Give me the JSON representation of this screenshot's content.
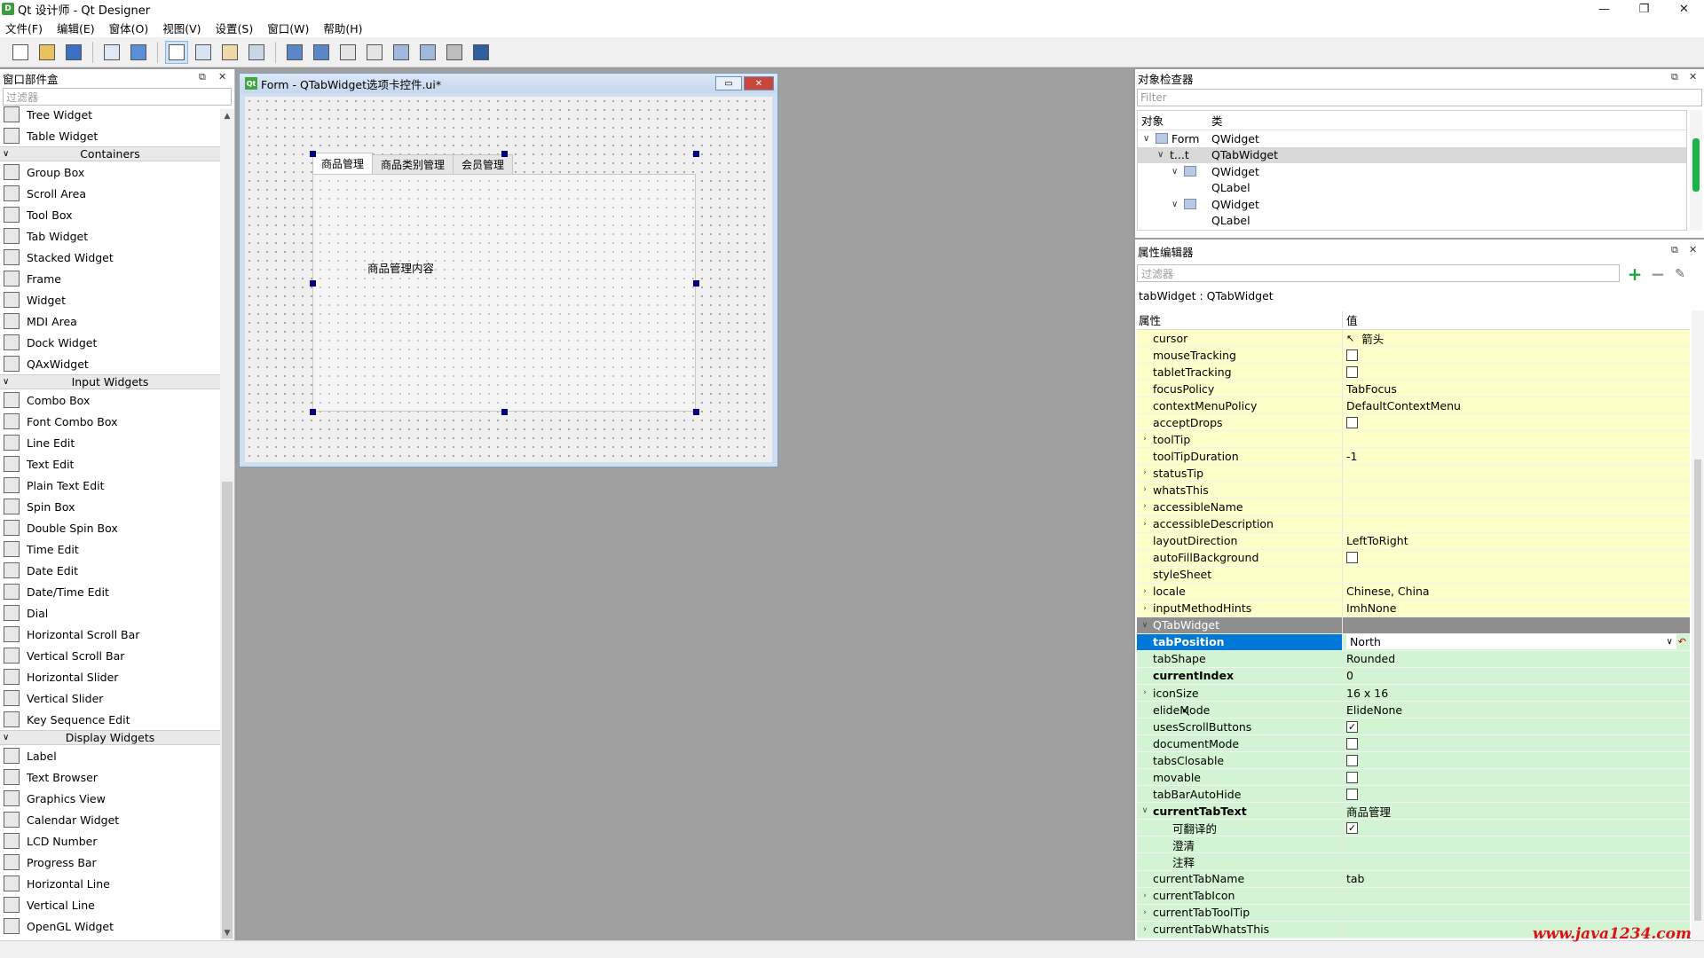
{
  "window": {
    "title": "Qt 设计师 - Qt Designer",
    "app_icon": "D",
    "controls": [
      "—",
      "❐",
      "✕"
    ]
  },
  "menubar": [
    "文件(F)",
    "编辑(E)",
    "窗体(O)",
    "视图(V)",
    "设置(S)",
    "窗口(W)",
    "帮助(H)"
  ],
  "widget_box": {
    "title": "窗口部件盒",
    "filter_placeholder": "过滤器",
    "items": [
      {
        "kind": "item",
        "label": "Tree Widget"
      },
      {
        "kind": "item",
        "label": "Table Widget"
      },
      {
        "kind": "category",
        "label": "Containers"
      },
      {
        "kind": "item",
        "label": "Group Box"
      },
      {
        "kind": "item",
        "label": "Scroll Area"
      },
      {
        "kind": "item",
        "label": "Tool Box"
      },
      {
        "kind": "item",
        "label": "Tab Widget"
      },
      {
        "kind": "item",
        "label": "Stacked Widget"
      },
      {
        "kind": "item",
        "label": "Frame"
      },
      {
        "kind": "item",
        "label": "Widget"
      },
      {
        "kind": "item",
        "label": "MDI Area"
      },
      {
        "kind": "item",
        "label": "Dock Widget"
      },
      {
        "kind": "item",
        "label": "QAxWidget"
      },
      {
        "kind": "category",
        "label": "Input Widgets"
      },
      {
        "kind": "item",
        "label": "Combo Box"
      },
      {
        "kind": "item",
        "label": "Font Combo Box"
      },
      {
        "kind": "item",
        "label": "Line Edit"
      },
      {
        "kind": "item",
        "label": "Text Edit"
      },
      {
        "kind": "item",
        "label": "Plain Text Edit"
      },
      {
        "kind": "item",
        "label": "Spin Box"
      },
      {
        "kind": "item",
        "label": "Double Spin Box"
      },
      {
        "kind": "item",
        "label": "Time Edit"
      },
      {
        "kind": "item",
        "label": "Date Edit"
      },
      {
        "kind": "item",
        "label": "Date/Time Edit"
      },
      {
        "kind": "item",
        "label": "Dial"
      },
      {
        "kind": "item",
        "label": "Horizontal Scroll Bar"
      },
      {
        "kind": "item",
        "label": "Vertical Scroll Bar"
      },
      {
        "kind": "item",
        "label": "Horizontal Slider"
      },
      {
        "kind": "item",
        "label": "Vertical Slider"
      },
      {
        "kind": "item",
        "label": "Key Sequence Edit"
      },
      {
        "kind": "category",
        "label": "Display Widgets"
      },
      {
        "kind": "item",
        "label": "Label"
      },
      {
        "kind": "item",
        "label": "Text Browser"
      },
      {
        "kind": "item",
        "label": "Graphics View"
      },
      {
        "kind": "item",
        "label": "Calendar Widget"
      },
      {
        "kind": "item",
        "label": "LCD Number"
      },
      {
        "kind": "item",
        "label": "Progress Bar"
      },
      {
        "kind": "item",
        "label": "Horizontal Line"
      },
      {
        "kind": "item",
        "label": "Vertical Line"
      },
      {
        "kind": "item",
        "label": "OpenGL Widget"
      }
    ]
  },
  "form": {
    "title": "Form - QTabWidget选项卡控件.ui*",
    "icon": "Qt",
    "tabs": [
      "商品管理",
      "商品类别管理",
      "会员管理"
    ],
    "current_tab": 0,
    "tab_content_label": "商品管理内容"
  },
  "object_inspector": {
    "title": "对象检查器",
    "filter_placeholder": "Filter",
    "col_object": "对象",
    "col_class": "类",
    "rows": [
      {
        "depth": 0,
        "expand": "∨",
        "name": "Form",
        "cls": "QWidget",
        "icon": true,
        "selected": false
      },
      {
        "depth": 1,
        "expand": "∨",
        "name": "t...t",
        "cls": "QTabWidget",
        "icon": false,
        "selected": true
      },
      {
        "depth": 2,
        "expand": "∨",
        "name": "",
        "cls": "QWidget",
        "icon": true,
        "selected": false
      },
      {
        "depth": 3,
        "expand": "",
        "name": "",
        "cls": "QLabel",
        "icon": false,
        "selected": false
      },
      {
        "depth": 2,
        "expand": "∨",
        "name": "",
        "cls": "QWidget",
        "icon": true,
        "selected": false
      },
      {
        "depth": 3,
        "expand": "",
        "name": "",
        "cls": "QLabel",
        "icon": false,
        "selected": false
      }
    ]
  },
  "property_editor": {
    "title": "属性编辑器",
    "filter_placeholder": "过滤器",
    "object_label": "tabWidget : QTabWidget",
    "col_property": "属性",
    "col_value": "值",
    "rows": [
      {
        "name": "cursor",
        "value": "箭头",
        "type": "cursor",
        "color": "yellow",
        "expand": ""
      },
      {
        "name": "mouseTracking",
        "value": "",
        "type": "check",
        "checked": false,
        "color": "yellow",
        "expand": ""
      },
      {
        "name": "tabletTracking",
        "value": "",
        "type": "check",
        "checked": false,
        "color": "yellow",
        "expand": ""
      },
      {
        "name": "focusPolicy",
        "value": "TabFocus",
        "type": "text",
        "color": "yellow",
        "expand": ""
      },
      {
        "name": "contextMenuPolicy",
        "value": "DefaultContextMenu",
        "type": "text",
        "color": "yellow",
        "expand": ""
      },
      {
        "name": "acceptDrops",
        "value": "",
        "type": "check",
        "checked": false,
        "color": "yellow",
        "expand": ""
      },
      {
        "name": "toolTip",
        "value": "",
        "type": "text",
        "color": "yellow",
        "expand": "›"
      },
      {
        "name": "toolTipDuration",
        "value": "-1",
        "type": "text",
        "color": "yellow",
        "expand": ""
      },
      {
        "name": "statusTip",
        "value": "",
        "type": "text",
        "color": "yellow",
        "expand": "›"
      },
      {
        "name": "whatsThis",
        "value": "",
        "type": "text",
        "color": "yellow",
        "expand": "›"
      },
      {
        "name": "accessibleName",
        "value": "",
        "type": "text",
        "color": "yellow",
        "expand": "›"
      },
      {
        "name": "accessibleDescription",
        "value": "",
        "type": "text",
        "color": "yellow",
        "expand": "›"
      },
      {
        "name": "layoutDirection",
        "value": "LeftToRight",
        "type": "text",
        "color": "yellow",
        "expand": ""
      },
      {
        "name": "autoFillBackground",
        "value": "",
        "type": "check",
        "checked": false,
        "color": "yellow",
        "expand": ""
      },
      {
        "name": "styleSheet",
        "value": "",
        "type": "text",
        "color": "yellow",
        "expand": ""
      },
      {
        "name": "locale",
        "value": "Chinese, China",
        "type": "text",
        "color": "yellow",
        "expand": "›"
      },
      {
        "name": "inputMethodHints",
        "value": "ImhNone",
        "type": "text",
        "color": "yellow",
        "expand": "›"
      },
      {
        "name": "QTabWidget",
        "value": "",
        "type": "category",
        "color": "cat",
        "expand": "∨"
      },
      {
        "name": "tabPosition",
        "value": "North",
        "type": "combo",
        "color": "green",
        "expand": "",
        "selected": true
      },
      {
        "name": "tabShape",
        "value": "Rounded",
        "type": "text",
        "color": "green",
        "expand": ""
      },
      {
        "name": "currentIndex",
        "value": "0",
        "type": "text",
        "color": "green",
        "expand": "",
        "bold": true
      },
      {
        "name": "iconSize",
        "value": "16 x 16",
        "type": "text",
        "color": "green",
        "expand": "›"
      },
      {
        "name": "elideMode",
        "value": "ElideNone",
        "type": "text",
        "color": "green",
        "expand": ""
      },
      {
        "name": "usesScrollButtons",
        "value": "",
        "type": "check",
        "checked": true,
        "color": "green",
        "expand": ""
      },
      {
        "name": "documentMode",
        "value": "",
        "type": "check",
        "checked": false,
        "color": "green",
        "expand": ""
      },
      {
        "name": "tabsClosable",
        "value": "",
        "type": "check",
        "checked": false,
        "color": "green",
        "expand": ""
      },
      {
        "name": "movable",
        "value": "",
        "type": "check",
        "checked": false,
        "color": "green",
        "expand": ""
      },
      {
        "name": "tabBarAutoHide",
        "value": "",
        "type": "check",
        "checked": false,
        "color": "green",
        "expand": ""
      },
      {
        "name": "currentTabText",
        "value": "商品管理",
        "type": "text",
        "color": "green",
        "expand": "∨",
        "bold": true
      },
      {
        "name": "可翻译的",
        "value": "",
        "type": "check",
        "checked": true,
        "color": "green",
        "expand": "",
        "sub": true
      },
      {
        "name": "澄清",
        "value": "",
        "type": "text",
        "color": "green",
        "expand": "",
        "sub": true
      },
      {
        "name": "注释",
        "value": "",
        "type": "text",
        "color": "green",
        "expand": "",
        "sub": true
      },
      {
        "name": "currentTabName",
        "value": "tab",
        "type": "text",
        "color": "green",
        "expand": ""
      },
      {
        "name": "currentTabIcon",
        "value": "",
        "type": "text",
        "color": "green",
        "expand": "›"
      },
      {
        "name": "currentTabToolTip",
        "value": "",
        "type": "text",
        "color": "green",
        "expand": "›"
      },
      {
        "name": "currentTabWhatsThis",
        "value": "",
        "type": "text",
        "color": "green",
        "expand": "›"
      }
    ]
  },
  "watermark": "www.java1234.com",
  "colors": {
    "selection": "#0078d7",
    "property_yellow": "#fefec8",
    "property_green": "#d2f4d2",
    "category_gray": "#8e8e8e",
    "handle": "#000080",
    "watermark": "#e0101a"
  }
}
